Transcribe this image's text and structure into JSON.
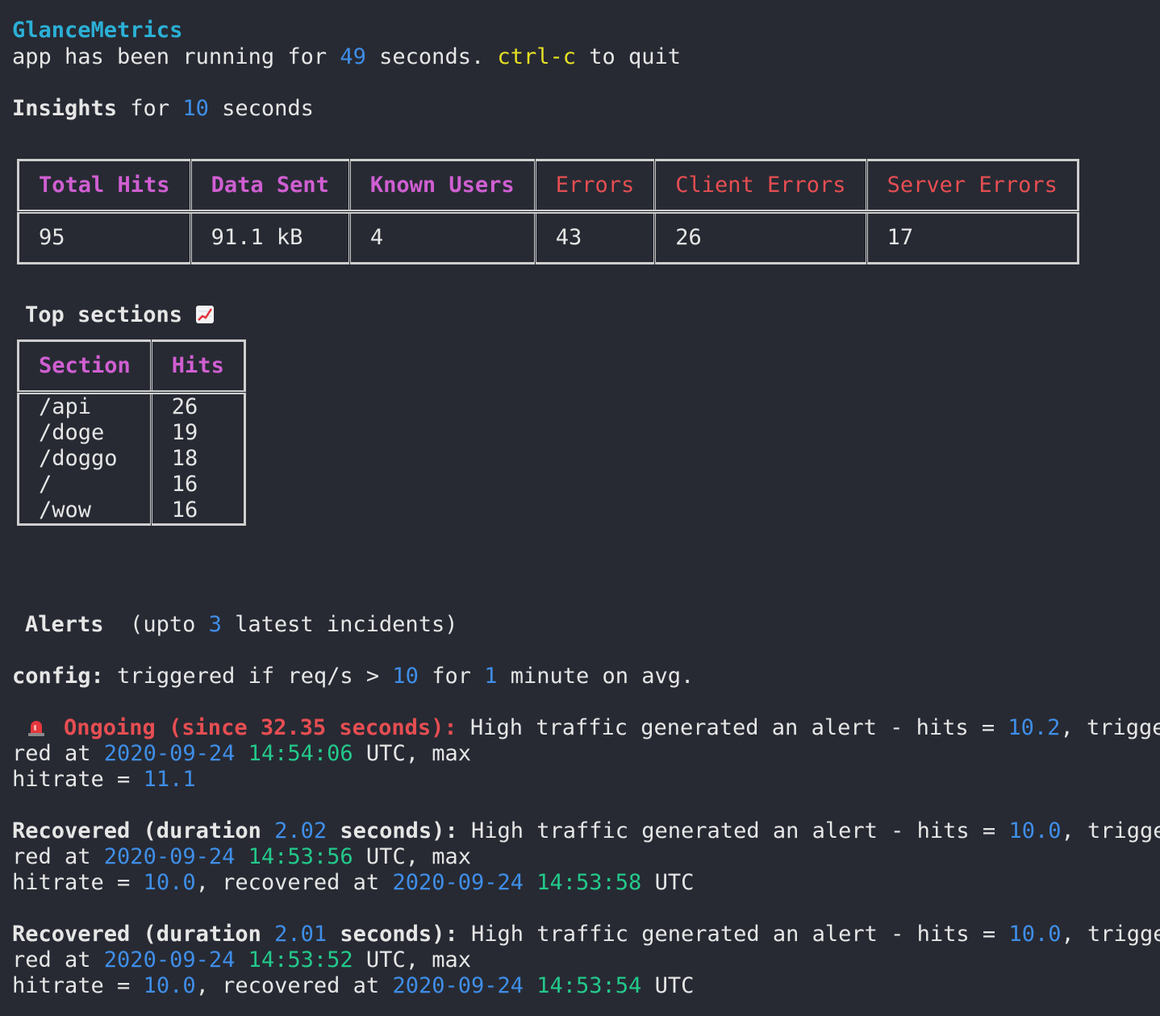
{
  "app": {
    "title": "GlanceMetrics",
    "running_prefix": "app has been running for ",
    "running_seconds": "49",
    "running_suffix": " seconds. ",
    "quit_key": "ctrl-c",
    "quit_suffix": " to quit"
  },
  "insights": {
    "label": "Insights",
    "for_text": " for ",
    "window": "10",
    "unit": " seconds"
  },
  "stats": {
    "headers": [
      "Total Hits",
      "Data Sent",
      "Known Users",
      "Errors",
      "Client Errors",
      "Server Errors"
    ],
    "values": [
      "95",
      "91.1 kB",
      "4",
      "43",
      "26",
      "17"
    ],
    "colors": {
      "neutral_header": "#d05fd2",
      "error_header": "#e64e52"
    }
  },
  "sections": {
    "title": "Top sections",
    "icon": "chart-increasing-icon",
    "headers": [
      "Section",
      "Hits"
    ],
    "rows": [
      [
        "/api",
        "26"
      ],
      [
        "/doge",
        "19"
      ],
      [
        "/doggo",
        "18"
      ],
      [
        "/",
        "16"
      ],
      [
        "/wow",
        "16"
      ]
    ]
  },
  "alerts": {
    "title": "Alerts",
    "sub_prefix": "  (upto ",
    "count": "3",
    "sub_suffix": " latest incidents)",
    "config_label": "config:",
    "config_a": " triggered if req/s > ",
    "threshold": "10",
    "config_b": " for ",
    "duration": "1",
    "config_c": " minute on avg.",
    "ongoing": {
      "icon": "rotating-light-icon",
      "status": "Ongoing (since 32.35 seconds):",
      "msg": " High traffic generated an alert - hits = ",
      "hits": "10.2",
      "msg2": ", trigge",
      "red_at": "red at ",
      "date": "2020-09-24",
      "time": "14:54:06",
      "utc_max": " UTC, max",
      "hitrate_label": "hitrate = ",
      "hitrate": "11.1"
    },
    "recovered": [
      {
        "label": "Recovered (duration ",
        "duration": "2.02",
        "label2": " seconds):",
        "msg": " High traffic generated an alert - hits = ",
        "hits": "10.0",
        "msg2": ", trigge",
        "red_at": "red at ",
        "date": "2020-09-24",
        "time": "14:53:56",
        "utc_max": " UTC, max",
        "hitrate_label": "hitrate = ",
        "hitrate": "10.0",
        "rec_text": ", recovered at ",
        "rec_date": "2020-09-24",
        "rec_time": "14:53:58",
        "utc": " UTC"
      },
      {
        "label": "Recovered (duration ",
        "duration": "2.01",
        "label2": " seconds):",
        "msg": " High traffic generated an alert - hits = ",
        "hits": "10.0",
        "msg2": ", trigge",
        "red_at": "red at ",
        "date": "2020-09-24",
        "time": "14:53:52",
        "utc_max": " UTC, max",
        "hitrate_label": "hitrate = ",
        "hitrate": "10.0",
        "rec_text": ", recovered at ",
        "rec_date": "2020-09-24",
        "rec_time": "14:53:54",
        "utc": " UTC"
      }
    ]
  }
}
